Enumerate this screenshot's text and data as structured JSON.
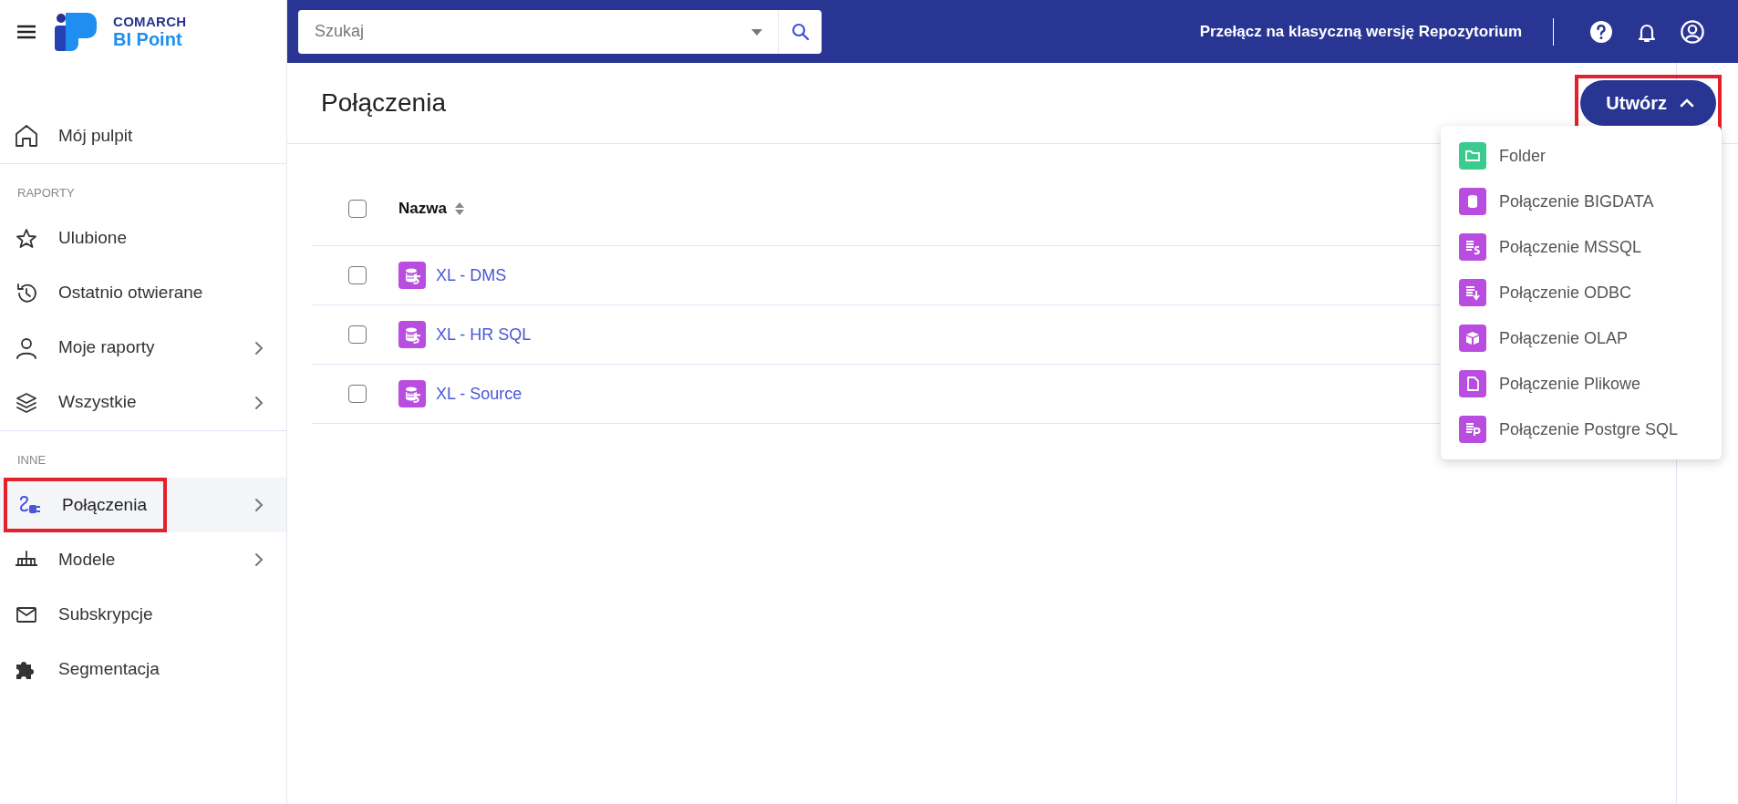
{
  "app": {
    "brand": "COMARCH",
    "product": "BI Point"
  },
  "topbar": {
    "search": {
      "placeholder": "Szukaj"
    },
    "switch_link": "Przełącz na klasyczną wersję Repozytorium"
  },
  "sidebar": {
    "items": [
      {
        "kind": "link",
        "label": "Mój pulpit",
        "selected": false,
        "has_submenu": false,
        "highlighted": false
      },
      {
        "kind": "heading",
        "label": "RAPORTY"
      },
      {
        "kind": "link",
        "label": "Ulubione",
        "selected": false,
        "has_submenu": false,
        "highlighted": false
      },
      {
        "kind": "link",
        "label": "Ostatnio otwierane",
        "selected": false,
        "has_submenu": false,
        "highlighted": false
      },
      {
        "kind": "link",
        "label": "Moje raporty",
        "selected": false,
        "has_submenu": true,
        "highlighted": false
      },
      {
        "kind": "link",
        "label": "Wszystkie",
        "selected": false,
        "has_submenu": true,
        "highlighted": false
      },
      {
        "kind": "heading",
        "label": "INNE"
      },
      {
        "kind": "link",
        "label": "Połączenia",
        "selected": true,
        "has_submenu": true,
        "highlighted": true
      },
      {
        "kind": "link",
        "label": "Modele",
        "selected": false,
        "has_submenu": true,
        "highlighted": false
      },
      {
        "kind": "link",
        "label": "Subskrypcje",
        "selected": false,
        "has_submenu": false,
        "highlighted": false
      },
      {
        "kind": "link",
        "label": "Segmentacja",
        "selected": false,
        "has_submenu": false,
        "highlighted": false
      }
    ]
  },
  "page": {
    "title": "Połączenia",
    "create_button": {
      "label": "Utwórz",
      "expanded": true,
      "highlighted": true
    },
    "create_menu": [
      {
        "label": "Folder",
        "color": "#3ccb8f"
      },
      {
        "label": "Połączenie BIGDATA",
        "color": "#b84ddf"
      },
      {
        "label": "Połączenie MSSQL",
        "color": "#b84ddf"
      },
      {
        "label": "Połączenie ODBC",
        "color": "#b84ddf"
      },
      {
        "label": "Połączenie OLAP",
        "color": "#b84ddf"
      },
      {
        "label": "Połączenie Plikowe",
        "color": "#b84ddf"
      },
      {
        "label": "Połączenie Postgre SQL",
        "color": "#b84ddf"
      }
    ],
    "table": {
      "columns": [
        {
          "label": "Nazwa",
          "checked": false
        }
      ],
      "rows": [
        {
          "name": "XL - DMS",
          "checked": false
        },
        {
          "name": "XL - HR SQL",
          "checked": false
        },
        {
          "name": "XL - Source",
          "checked": false
        }
      ]
    }
  }
}
